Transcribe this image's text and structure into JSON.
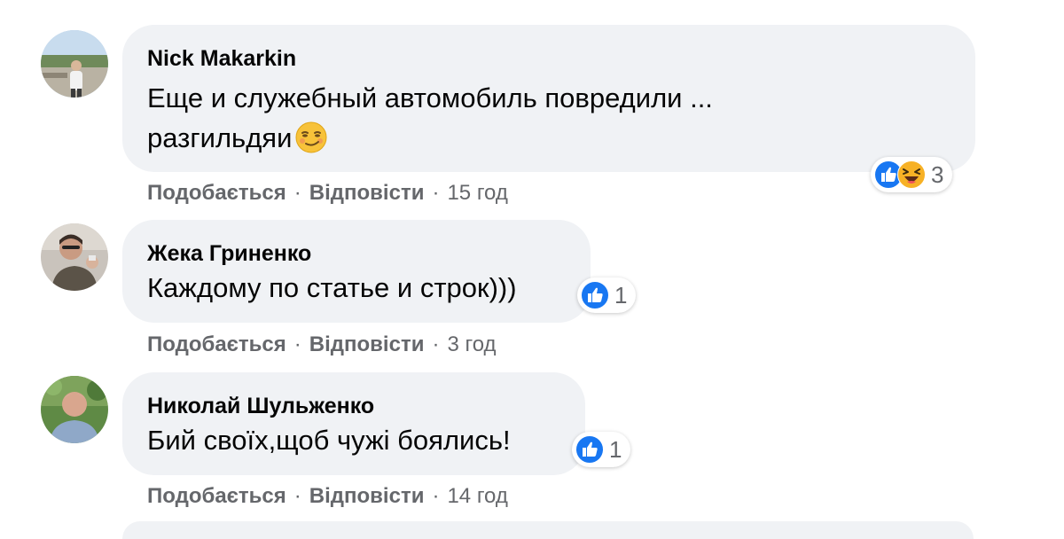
{
  "comments": [
    {
      "author": "Nick Makarkin",
      "text_line1": "Еще и служебный автомобиль повредили ...",
      "text_line2": "разгильдяи",
      "emoji": "smirk-emoji",
      "reactions": [
        "like-icon",
        "haha-icon"
      ],
      "reaction_count": "3",
      "like_label": "Подобається",
      "reply_label": "Відповісти",
      "time": "15 год"
    },
    {
      "author": "Жека Гриненко",
      "text": "Каждому по статье и строк)))",
      "reactions": [
        "like-icon"
      ],
      "reaction_count": "1",
      "like_label": "Подобається",
      "reply_label": "Відповісти",
      "time": "3 год"
    },
    {
      "author": "Николай Шульженко",
      "text": "Бий своїх,щоб чужі боялись!",
      "reactions": [
        "like-icon"
      ],
      "reaction_count": "1",
      "like_label": "Подобається",
      "reply_label": "Відповісти",
      "time": "14 год"
    }
  ],
  "separator": "·",
  "colors": {
    "bubble": "#f0f2f5",
    "text": "#050505",
    "secondary": "#65676b",
    "like_blue": "#1877f2",
    "haha_yellow": "#f7b125"
  }
}
